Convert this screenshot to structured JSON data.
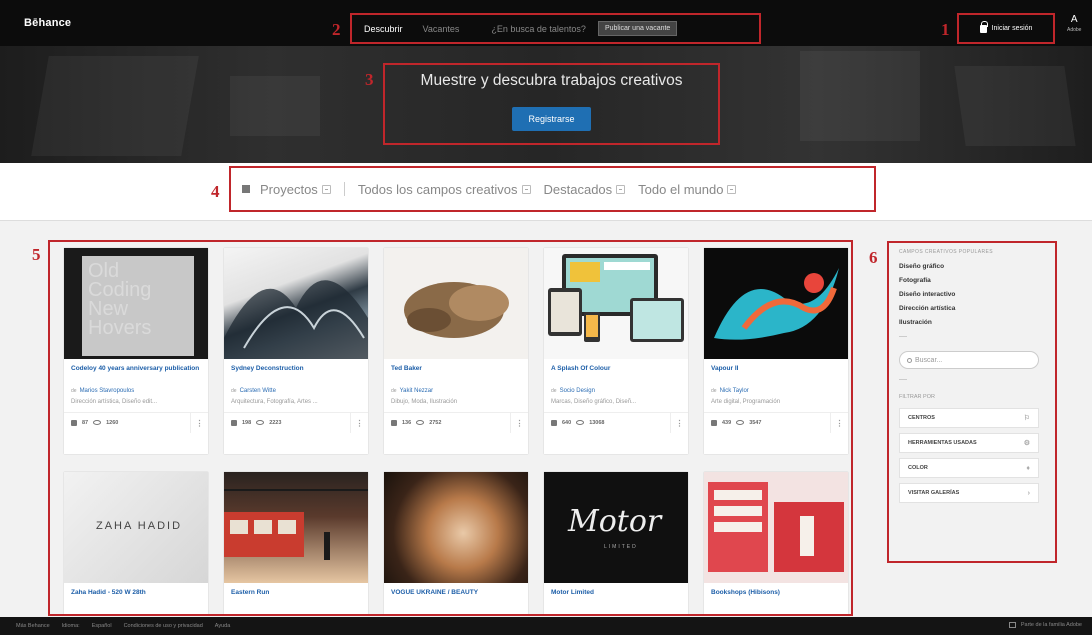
{
  "brand": "Bēhance",
  "nav": {
    "discover": "Descubrir",
    "jobs": "Vacantes",
    "talent_question": "¿En busca de talentos?",
    "publish_button": "Publicar una vacante",
    "login": "Iniciar sesión",
    "adobe_logo": "A",
    "adobe_label": "Adobe"
  },
  "hero": {
    "title": "Muestre y descubra trabajos creativos",
    "register_button": "Registrarse"
  },
  "filters": {
    "projects": "Proyectos",
    "fields": "Todos los campos creativos",
    "featured": "Destacados",
    "location": "Todo el mundo"
  },
  "callouts": [
    "1",
    "2",
    "3",
    "4",
    "5",
    "6"
  ],
  "projects": [
    {
      "title": "Codeloy 40 years anniversary publication",
      "owner": "Marios Stavropoulos",
      "fields": "Dirección artística, Diseño edit...",
      "likes": "87",
      "views": "1260"
    },
    {
      "title": "Sydney Deconstruction",
      "owner": "Carsten Witte",
      "fields": "Arquitectura, Fotografía, Artes ...",
      "likes": "198",
      "views": "2223"
    },
    {
      "title": "Ted Baker",
      "owner": "Yakit Nezzar",
      "fields": "Dibujo, Moda, Ilustración",
      "likes": "136",
      "views": "2752"
    },
    {
      "title": "A Splash Of Colour",
      "owner": "Socio Design",
      "fields": "Marcas, Diseño gráfico, Diseñ...",
      "likes": "640",
      "views": "13068"
    },
    {
      "title": "Vapour II",
      "owner": "Nick Taylor",
      "fields": "Arte digital, Programación",
      "likes": "439",
      "views": "3547"
    },
    {
      "title": "Zaha Hadid - 520 W 28th",
      "owner": "",
      "fields": "",
      "likes": "",
      "views": ""
    },
    {
      "title": "Eastern Run",
      "owner": "",
      "fields": "",
      "likes": "",
      "views": ""
    },
    {
      "title": "VOGUE UKRAINE / BEAUTY",
      "owner": "",
      "fields": "",
      "likes": "",
      "views": ""
    },
    {
      "title": "Motor Limited",
      "owner": "",
      "fields": "",
      "likes": "",
      "views": ""
    },
    {
      "title": "Bookshops (Hibisons)",
      "owner": "",
      "fields": "",
      "likes": "",
      "views": ""
    }
  ],
  "thumb_text": {
    "zaha": "ZAHA HADID",
    "motor": "Motor",
    "motor_sub": "LIMITED",
    "codeloy": "Old Coding New Hovers"
  },
  "sidebar": {
    "heading": "CAMPOS CREATIVOS POPULARES",
    "links": [
      "Diseño gráfico",
      "Fotografía",
      "Diseño interactivo",
      "Dirección artística",
      "Ilustración"
    ],
    "search_placeholder": "Buscar...",
    "filter_heading": "FILTRAR POR",
    "filter_buttons": [
      "CENTROS",
      "HERRAMIENTAS USADAS",
      "COLOR",
      "VISITAR GALERÍAS"
    ]
  },
  "footer": {
    "items": [
      "Más Behance",
      "Idioma:",
      "Español",
      "Condiciones de uso y privacidad",
      "Ayuda"
    ],
    "right": "Parte de la familia Adobe"
  },
  "colors": {
    "accent_red": "#c0262b",
    "link_blue": "#1c5ea8",
    "button_blue": "#1f6fb3",
    "topbar": "#0c0c0c"
  },
  "icons": [
    "lock-icon",
    "grid-icon",
    "chevron-down-icon",
    "thumbs-up-icon",
    "eye-icon",
    "search-icon",
    "facebook-icon"
  ]
}
